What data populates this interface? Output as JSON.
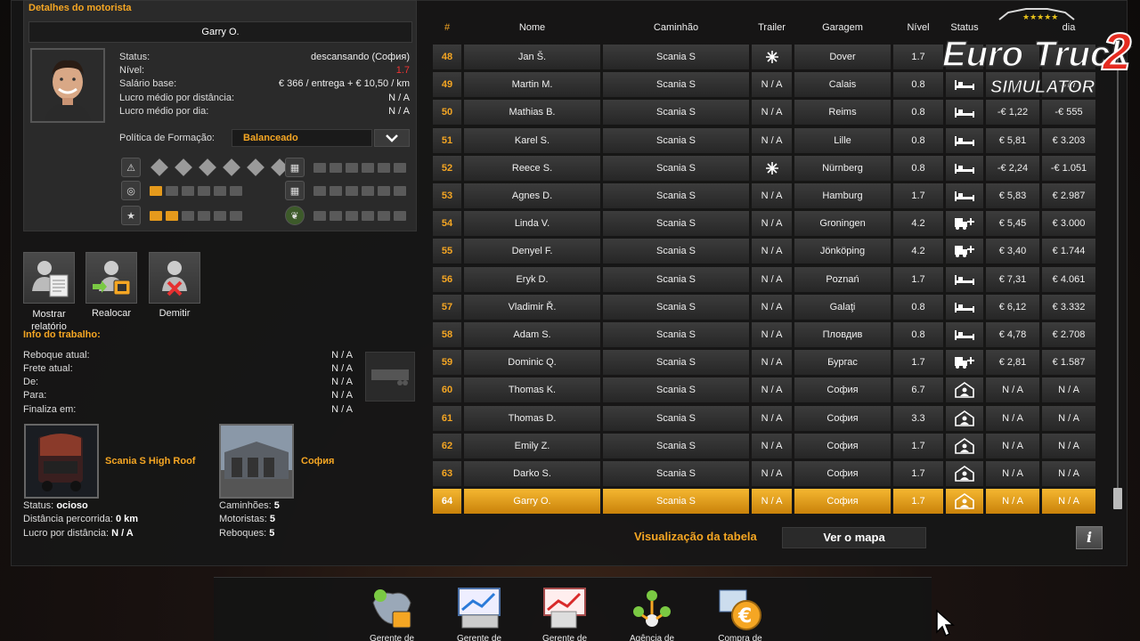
{
  "details": {
    "title": "Detalhes do motorista",
    "name": "Garry O.",
    "rows": [
      {
        "label": "Status:",
        "value": "descansando (София)"
      },
      {
        "label": "Nível:",
        "value": "1.7"
      },
      {
        "label": "Salário base:",
        "value": "€ 366 / entrega + € 10,50 / km"
      },
      {
        "label": "Lucro médio por distância:",
        "value": "N / A"
      },
      {
        "label": "Lucro médio por dia:",
        "value": "N / A"
      }
    ],
    "policy_label": "Política de Formação:",
    "policy_value": "Balanceado",
    "skills": {
      "adr_level": 0,
      "long_distance": 1,
      "high_value": 2,
      "fragile": 0,
      "just_in_time": 0,
      "eco_driving": 0,
      "max": 6
    }
  },
  "actions": [
    {
      "label": "Mostrar relatório"
    },
    {
      "label": "Realocar"
    },
    {
      "label": "Demitir"
    }
  ],
  "job": {
    "title": "Info do trabalho:",
    "rows": [
      {
        "label": "Reboque atual:",
        "value": "N / A"
      },
      {
        "label": "Frete atual:",
        "value": "N / A"
      },
      {
        "label": "De:",
        "value": "N / A"
      },
      {
        "label": "Para:",
        "value": "N / A"
      },
      {
        "label": "Finaliza em:",
        "value": "N / A"
      }
    ]
  },
  "truck": {
    "name": "Scania S High Roof",
    "status_label": "Status:",
    "status_value": "ocioso",
    "distance_label": "Distância percorrida:",
    "distance_value": "0 km",
    "profit_label": "Lucro por distância:",
    "profit_value": "N / A"
  },
  "garage": {
    "name": "София",
    "trucks_label": "Caminhões:",
    "trucks_value": "5",
    "drivers_label": "Motoristas:",
    "drivers_value": "5",
    "trailers_label": "Reboques:",
    "trailers_value": "5"
  },
  "table": {
    "headers": [
      "#",
      "Nome",
      "Caminhão",
      "Trailer",
      "Garagem",
      "Nível",
      "Status",
      "",
      "dia"
    ],
    "rows": [
      {
        "num": "48",
        "name": "Jan Š.",
        "truck": "Scania S",
        "trailer": "snowflake",
        "garage": "Dover",
        "level": "1.7",
        "status": "none",
        "pd": "",
        "pday": ""
      },
      {
        "num": "49",
        "name": "Martin M.",
        "truck": "Scania S",
        "trailer": "N / A",
        "garage": "Calais",
        "level": "0.8",
        "status": "bed",
        "pd": "",
        "pday": "377"
      },
      {
        "num": "50",
        "name": "Mathias B.",
        "truck": "Scania S",
        "trailer": "N / A",
        "garage": "Reims",
        "level": "0.8",
        "status": "bed",
        "pd": "-€ 1,22",
        "pday": "-€ 555"
      },
      {
        "num": "51",
        "name": "Karel S.",
        "truck": "Scania S",
        "trailer": "N / A",
        "garage": "Lille",
        "level": "0.8",
        "status": "bed",
        "pd": "€ 5,81",
        "pday": "€ 3.203"
      },
      {
        "num": "52",
        "name": "Reece S.",
        "truck": "Scania S",
        "trailer": "snowflake",
        "garage": "Nürnberg",
        "level": "0.8",
        "status": "bed",
        "pd": "-€ 2,24",
        "pday": "-€ 1.051"
      },
      {
        "num": "53",
        "name": "Agnes D.",
        "truck": "Scania S",
        "trailer": "N / A",
        "garage": "Hamburg",
        "level": "1.7",
        "status": "bed",
        "pd": "€ 5,83",
        "pday": "€ 2.987"
      },
      {
        "num": "54",
        "name": "Linda V.",
        "truck": "Scania S",
        "trailer": "N / A",
        "garage": "Groningen",
        "level": "4.2",
        "status": "truck",
        "pd": "€ 5,45",
        "pday": "€ 3.000"
      },
      {
        "num": "55",
        "name": "Denyel F.",
        "truck": "Scania S",
        "trailer": "N / A",
        "garage": "Jönköping",
        "level": "4.2",
        "status": "truck",
        "pd": "€ 3,40",
        "pday": "€ 1.744"
      },
      {
        "num": "56",
        "name": "Eryk D.",
        "truck": "Scania S",
        "trailer": "N / A",
        "garage": "Poznań",
        "level": "1.7",
        "status": "bed",
        "pd": "€ 7,31",
        "pday": "€ 4.061"
      },
      {
        "num": "57",
        "name": "Vladimir Ř.",
        "truck": "Scania S",
        "trailer": "N / A",
        "garage": "Galaţi",
        "level": "0.8",
        "status": "bed",
        "pd": "€ 6,12",
        "pday": "€ 3.332"
      },
      {
        "num": "58",
        "name": "Adam S.",
        "truck": "Scania S",
        "trailer": "N / A",
        "garage": "Пловдив",
        "level": "0.8",
        "status": "bed",
        "pd": "€ 4,78",
        "pday": "€ 2.708"
      },
      {
        "num": "59",
        "name": "Dominic Q.",
        "truck": "Scania S",
        "trailer": "N / A",
        "garage": "Бургас",
        "level": "1.7",
        "status": "truck",
        "pd": "€ 2,81",
        "pday": "€ 1.587"
      },
      {
        "num": "60",
        "name": "Thomas K.",
        "truck": "Scania S",
        "trailer": "N / A",
        "garage": "София",
        "level": "6.7",
        "status": "home",
        "pd": "N / A",
        "pday": "N / A"
      },
      {
        "num": "61",
        "name": "Thomas D.",
        "truck": "Scania S",
        "trailer": "N / A",
        "garage": "София",
        "level": "3.3",
        "status": "home",
        "pd": "N / A",
        "pday": "N / A"
      },
      {
        "num": "62",
        "name": "Emily Z.",
        "truck": "Scania S",
        "trailer": "N / A",
        "garage": "София",
        "level": "1.7",
        "status": "home",
        "pd": "N / A",
        "pday": "N / A"
      },
      {
        "num": "63",
        "name": "Darko S.",
        "truck": "Scania S",
        "trailer": "N / A",
        "garage": "София",
        "level": "1.7",
        "status": "home",
        "pd": "N / A",
        "pday": "N / A"
      },
      {
        "num": "64",
        "name": "Garry O.",
        "truck": "Scania S",
        "trailer": "N / A",
        "garage": "София",
        "level": "1.7",
        "status": "home",
        "pd": "N / A",
        "pday": "N / A",
        "selected": true
      }
    ]
  },
  "views": {
    "table_label": "Visualização da tabela",
    "map_label": "Ver o mapa",
    "info_label": "i"
  },
  "logo": {
    "line1": "Euro Truck",
    "num": "2",
    "line2": "SIMULATOR"
  },
  "dock": [
    {
      "label": "Gerente de"
    },
    {
      "label": "Gerente de"
    },
    {
      "label": "Gerente de"
    },
    {
      "label": "Agência de"
    },
    {
      "label": "Compra de"
    }
  ],
  "colors": {
    "accent": "#f5a623",
    "selected": "#e8a21f",
    "negative": "#e33333"
  }
}
